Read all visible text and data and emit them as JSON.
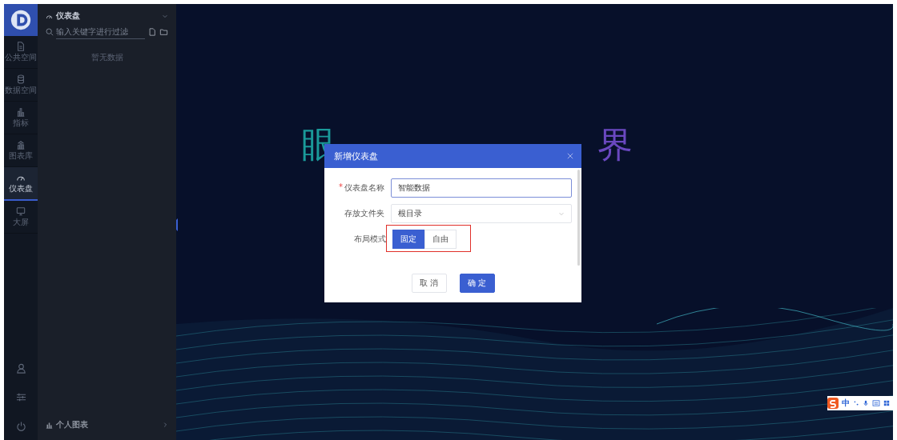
{
  "rail": {
    "items": [
      {
        "kind": "document",
        "label": "公共空间",
        "selected": false
      },
      {
        "kind": "database",
        "label": "数据空间",
        "selected": false
      },
      {
        "kind": "bars",
        "label": "指标",
        "selected": false
      },
      {
        "kind": "library",
        "label": "图表库",
        "selected": false
      },
      {
        "kind": "gauge",
        "label": "仪表盘",
        "selected": true
      },
      {
        "kind": "monitor",
        "label": "大屏",
        "selected": false
      }
    ],
    "bottom_icons": [
      {
        "kind": "user"
      },
      {
        "kind": "sliders"
      },
      {
        "kind": "power"
      }
    ]
  },
  "panel": {
    "title": "仪表盘",
    "search": {
      "placeholder": "输入关键字进行过滤"
    },
    "empty_text": "暂无数据",
    "footer": "个人图表"
  },
  "backdrop": {
    "heading": [
      "眼",
      "界"
    ]
  },
  "dialog": {
    "title": "新增仪表盘",
    "fields": [
      {
        "kind": "input",
        "label": "仪表盘名称",
        "required_mark": "*",
        "value": "智能数据",
        "focused": true
      },
      {
        "kind": "select",
        "label": "存放文件夹",
        "value": "根目录"
      },
      {
        "kind": "segmented",
        "label": "布局模式",
        "highlighted": true,
        "options": [
          {
            "label": "固定",
            "selected": true
          },
          {
            "label": "自由",
            "selected": false
          }
        ]
      }
    ],
    "buttons": [
      {
        "kind": "secondary",
        "label": "取 消"
      },
      {
        "kind": "primary",
        "label": "确 定"
      }
    ]
  },
  "ime_toolbar": {
    "mode": "中"
  }
}
